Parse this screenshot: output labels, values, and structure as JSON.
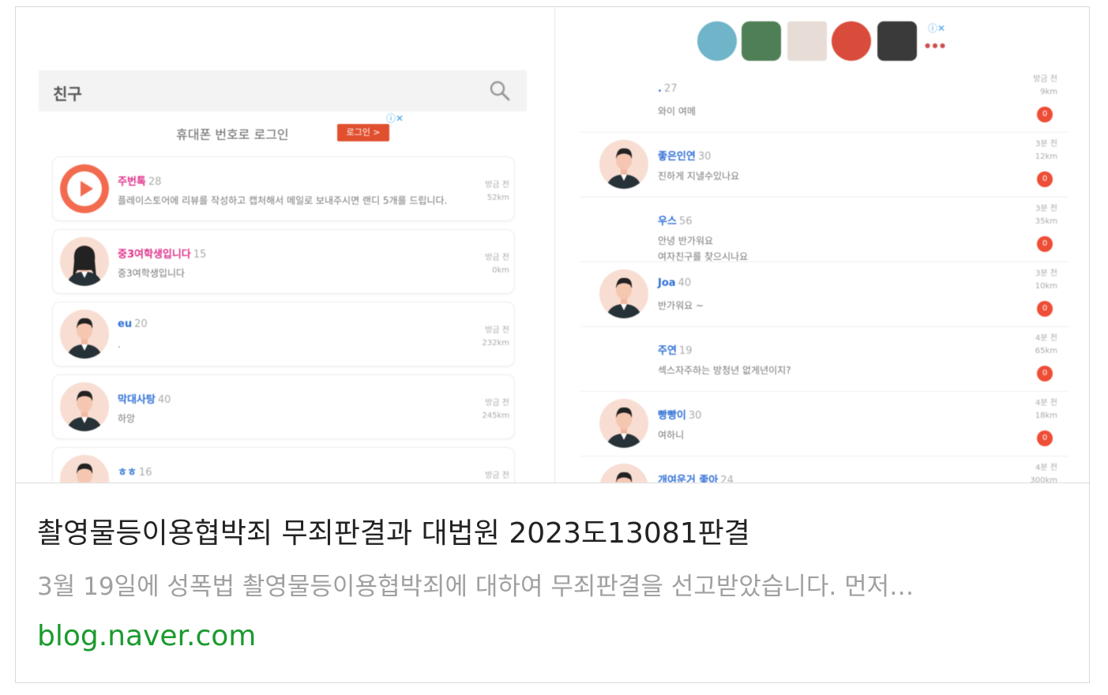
{
  "left_panel": {
    "search_title": "친구",
    "ad": {
      "text": "휴대폰 번호로 로그인",
      "button": "로그인 >"
    },
    "friends": [
      {
        "name": "주번톡",
        "age": "28",
        "message": "플레이스토어에 리뷰를 작성하고 캡처해서 메일로 보내주시면 랜디 5개를 드립니다.",
        "time": "방금 전",
        "distance": "52km",
        "name_color": "#e0308a"
      },
      {
        "name": "중3여학생입니다",
        "age": "15",
        "message": "중3여학생입니다",
        "time": "방금 전",
        "distance": "0km",
        "name_color": "#e0308a"
      },
      {
        "name": "eu",
        "age": "20",
        "message": ".",
        "time": "방금 전",
        "distance": "232km",
        "name_color": "#2f6fd6"
      },
      {
        "name": "막대사탕",
        "age": "40",
        "message": "하앙",
        "time": "방금 전",
        "distance": "245km",
        "name_color": "#2f6fd6"
      },
      {
        "name": "ㅎㅎ",
        "age": "16",
        "message": "",
        "time": "방금 전",
        "distance": "",
        "name_color": "#2f6fd6"
      }
    ]
  },
  "right_panel": {
    "chats": [
      {
        "name": ".",
        "age": "27",
        "message": "와이 여메",
        "time": "방금 전",
        "distance": "9km",
        "badge": "0",
        "avatar": false
      },
      {
        "name": "좋은인연",
        "age": "30",
        "message": "진하게 지낼수있나요",
        "time": "3분 전",
        "distance": "12km",
        "badge": "0",
        "avatar": true
      },
      {
        "name": "우스",
        "age": "56",
        "message": "안녕 반가워요\n여자친구를 찾으시나요",
        "time": "3분 전",
        "distance": "35km",
        "badge": "0",
        "avatar": false
      },
      {
        "name": "Joa",
        "age": "40",
        "message": "반가워요 ~",
        "time": "3분 전",
        "distance": "10km",
        "badge": "0",
        "avatar": true
      },
      {
        "name": "주연",
        "age": "19",
        "message": "섹스자주하는 방청년 없게년이지?",
        "time": "4분 전",
        "distance": "65km",
        "badge": "0",
        "avatar": false
      },
      {
        "name": "빵빵이",
        "age": "30",
        "message": "여하니",
        "time": "4분 전",
        "distance": "18km",
        "badge": "0",
        "avatar": true
      },
      {
        "name": "개여운거 좋아",
        "age": "24",
        "message": "",
        "time": "4분 전",
        "distance": "300km",
        "badge": "",
        "avatar": true
      }
    ]
  },
  "link": {
    "title": "촬영물등이용협박죄 무죄판결과 대법원 2023도13081판결",
    "description": "3월 19일에 성폭법 촬영물등이용협박죄에 대하여 무죄판결을 선고받았습니다. 먼저…",
    "url": "blog.naver.com"
  },
  "colors": {
    "url": "#1a9a2e",
    "badge": "#ee4d36",
    "accent": "#e0502e"
  }
}
